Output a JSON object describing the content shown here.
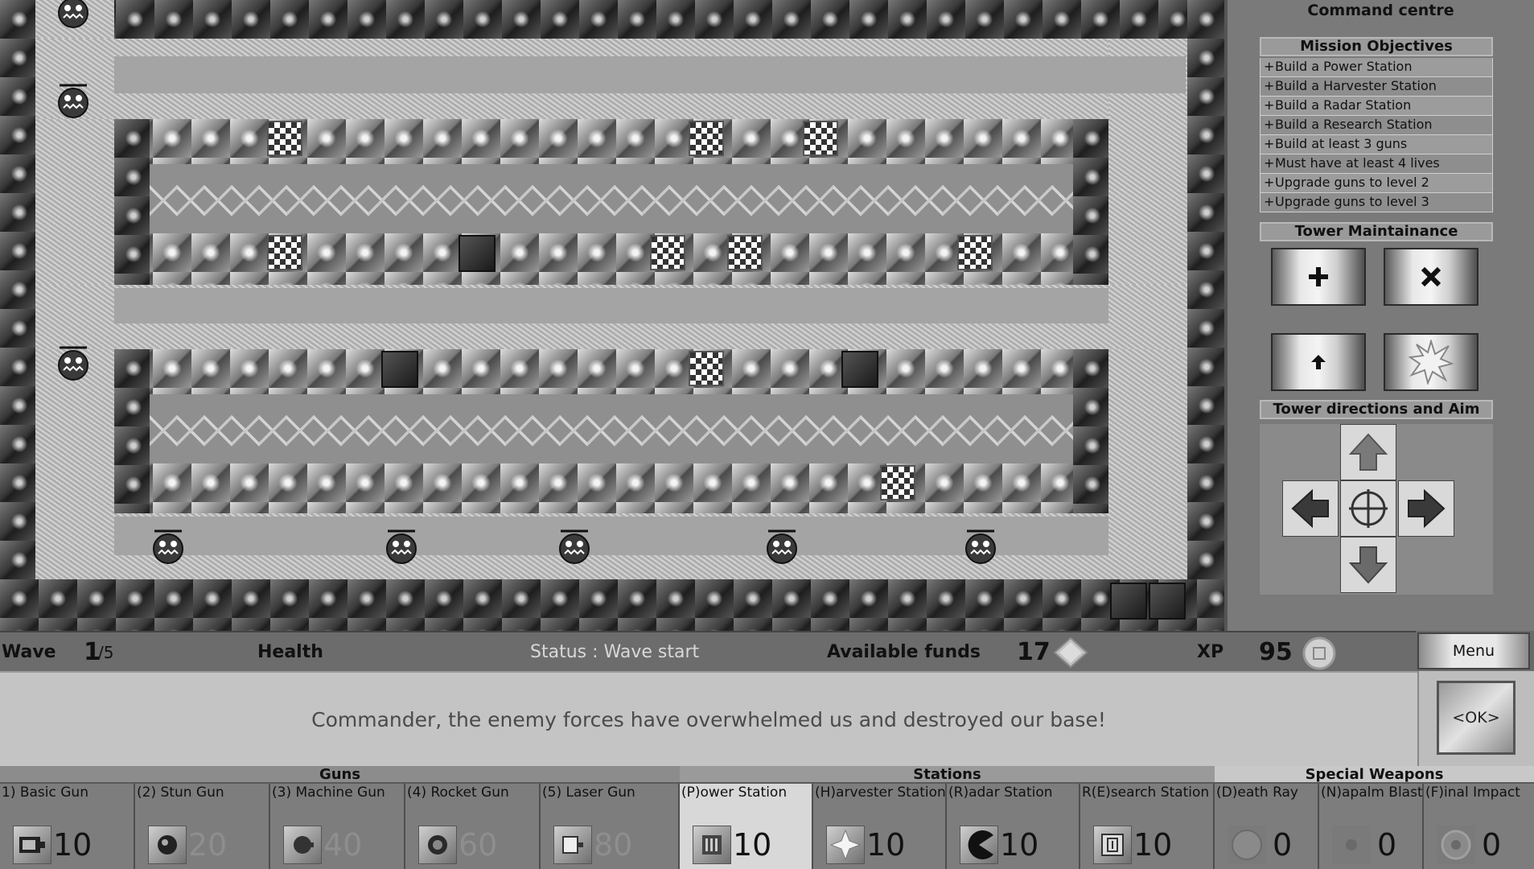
{
  "command_centre": {
    "title": "Command centre",
    "objectives_title": "Mission Objectives",
    "objectives": [
      "Build a Power Station",
      "Build a Harvester Station",
      "Build a Radar Station",
      "Build a Research Station",
      "Build at least 3 guns",
      "Must have at least 4 lives",
      "Upgrade guns to level 2",
      "Upgrade guns to level 3"
    ],
    "objective_bullet": "+",
    "maintenance_title": "Tower Maintainance",
    "maintenance_buttons": [
      "add-icon",
      "close-icon",
      "upgrade-arrow-icon",
      "explode-icon"
    ],
    "aim_title": "Tower directions and Aim"
  },
  "status": {
    "wave_label": "Wave",
    "wave_current": "1",
    "wave_total": "/5",
    "health_label": "Health",
    "status_text": "Status : Wave start",
    "funds_label": "Available funds",
    "funds_value": "17",
    "xp_label": "XP",
    "xp_value": "95",
    "menu_label": "Menu"
  },
  "message": {
    "text": "Commander, the enemy forces have overwhelmed us and destroyed our base!",
    "ok_label": "<OK>"
  },
  "build": {
    "categories": [
      {
        "name": "Guns"
      },
      {
        "name": "Stations"
      },
      {
        "name": "Special Weapons"
      }
    ],
    "items": [
      {
        "label": "1) Basic Gun",
        "cost": "10",
        "icon": "basic-gun-icon",
        "affordable": true
      },
      {
        "label": "(2) Stun Gun",
        "cost": "20",
        "icon": "stun-gun-icon",
        "affordable": false
      },
      {
        "label": "(3) Machine Gun",
        "cost": "40",
        "icon": "machine-gun-icon",
        "affordable": false
      },
      {
        "label": "(4) Rocket Gun",
        "cost": "60",
        "icon": "rocket-gun-icon",
        "affordable": false
      },
      {
        "label": "(5) Laser Gun",
        "cost": "80",
        "icon": "laser-gun-icon",
        "affordable": false
      },
      {
        "label": "(P)ower Station",
        "cost": "10",
        "icon": "power-station-icon",
        "affordable": true
      },
      {
        "label": "(H)arvester Station",
        "cost": "10",
        "icon": "harvester-station-icon",
        "affordable": true
      },
      {
        "label": "(R)adar Station",
        "cost": "10",
        "icon": "radar-station-icon",
        "affordable": true
      },
      {
        "label": "R(E)search Station",
        "cost": "10",
        "icon": "research-station-icon",
        "affordable": true
      },
      {
        "label": "(D)eath Ray",
        "cost": "0",
        "icon": "death-ray-icon",
        "affordable": true
      },
      {
        "label": "(N)apalm Blast",
        "cost": "0",
        "icon": "napalm-blast-icon",
        "affordable": true
      },
      {
        "label": "(F)inal Impact",
        "cost": "0",
        "icon": "final-impact-icon",
        "affordable": true
      }
    ]
  },
  "colors": {
    "panel": "#7a7a7a",
    "header": "#9a9a9a",
    "message_bg": "#c4c4c4",
    "dim_cost": "#8e8e8e"
  }
}
